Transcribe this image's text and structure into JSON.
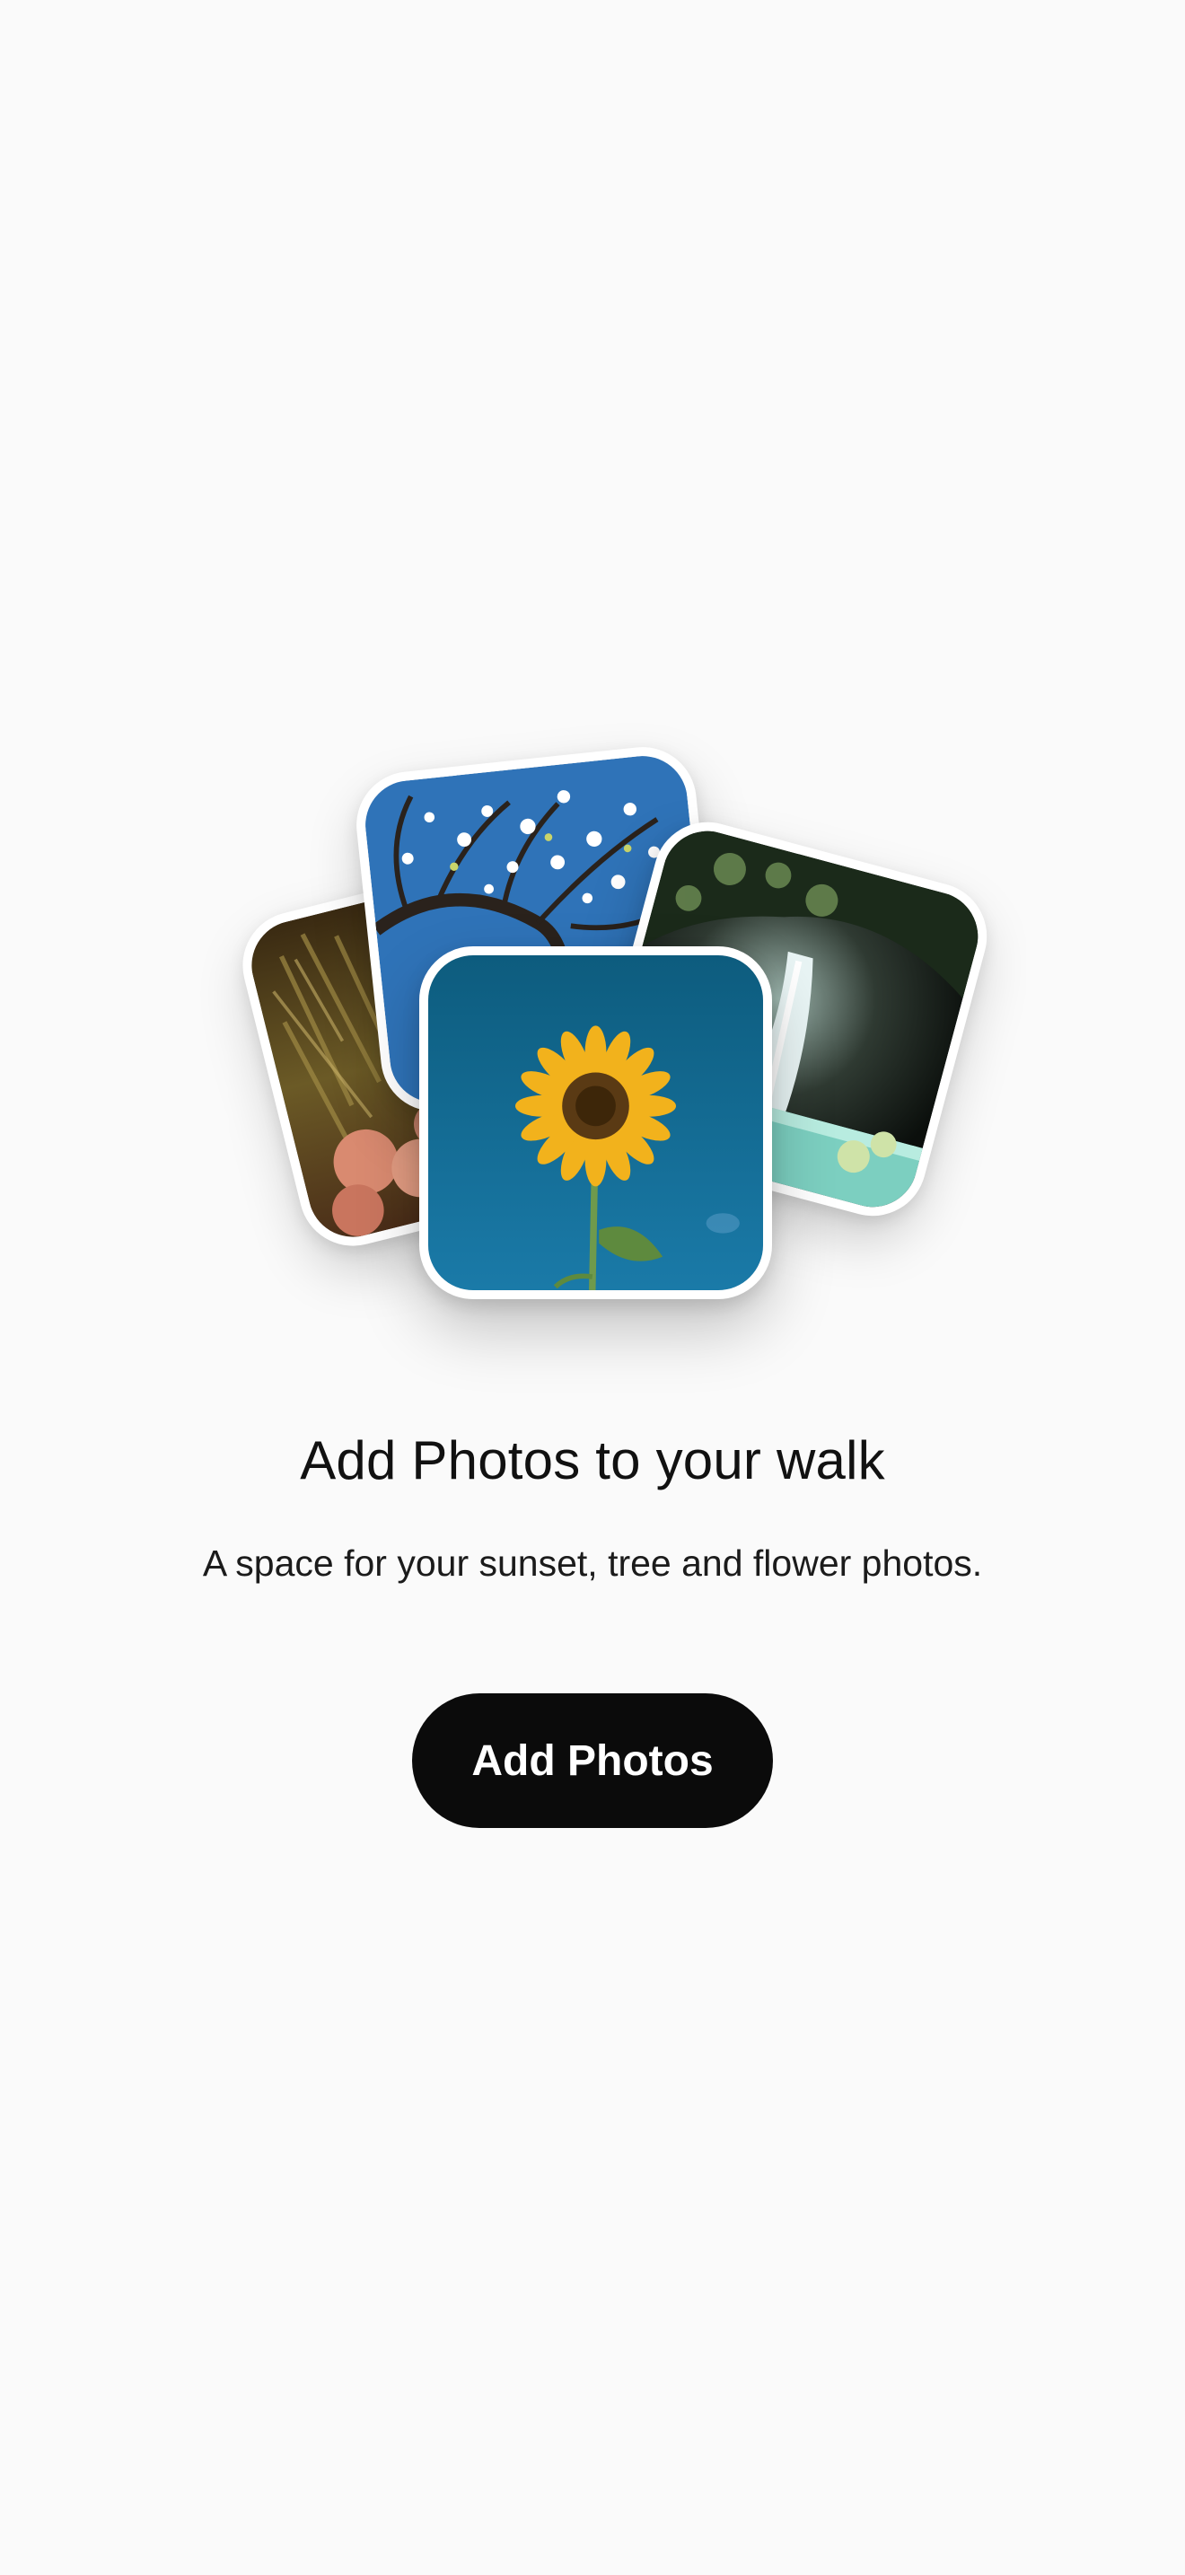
{
  "empty_state": {
    "title": "Add Photos to your walk",
    "subtitle": "A space for your sunset, tree and flower photos.",
    "button_label": "Add Photos"
  },
  "collage": {
    "photos": [
      "autumn-leaves-photo",
      "blossom-tree-photo",
      "waterfall-photo",
      "sunflower-photo"
    ]
  },
  "colors": {
    "background": "#fafafa",
    "button_bg": "#0b0b0b",
    "button_text": "#ffffff",
    "text": "#111111"
  }
}
